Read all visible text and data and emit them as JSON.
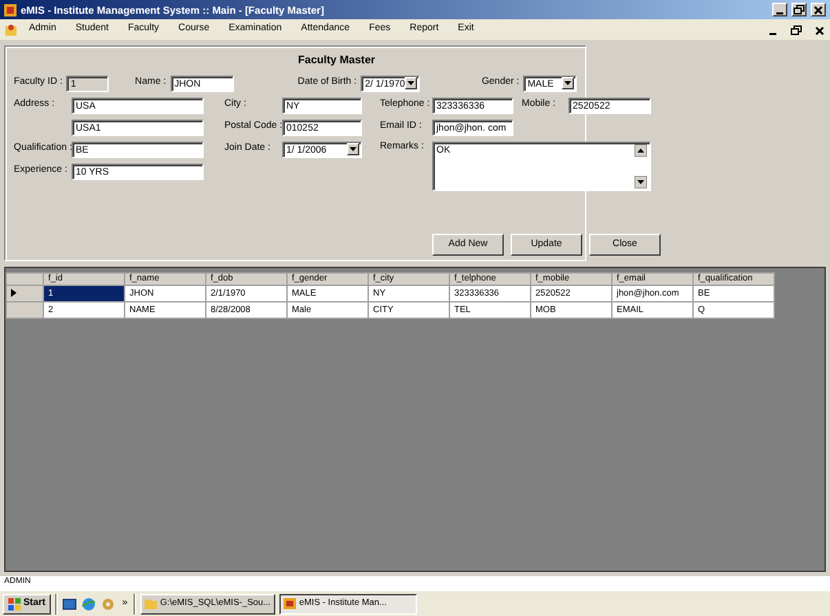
{
  "window": {
    "title": "eMIS - Institute Management System :: Main - [Faculty Master]"
  },
  "menu": {
    "items": [
      "Admin",
      "Student",
      "Faculty",
      "Course",
      "Examination",
      "Attendance",
      "Fees",
      "Report",
      "Exit"
    ]
  },
  "form": {
    "title": "Faculty Master",
    "fields": [
      {
        "label": "Faculty ID :",
        "value": "1",
        "kind": "readonly"
      },
      {
        "label": "Name :",
        "value": "JHON",
        "kind": "text"
      },
      {
        "label": "Date of Birth :",
        "value": "2/ 1/1970",
        "kind": "combo"
      },
      {
        "label": "Gender :",
        "value": "MALE",
        "kind": "combo"
      },
      {
        "label": "Address :",
        "value": "USA",
        "kind": "text"
      },
      {
        "label": "City :",
        "value": "NY",
        "kind": "text"
      },
      {
        "label": "Telephone :",
        "value": "323336336",
        "kind": "text"
      },
      {
        "label": "Mobile :",
        "value": "2520522",
        "kind": "text"
      },
      {
        "value": "USA1",
        "kind": "text"
      },
      {
        "label": "Postal Code :",
        "value": "010252",
        "kind": "text"
      },
      {
        "label": "Email ID :",
        "value": "jhon@jhon. com",
        "kind": "text"
      },
      {
        "label": "Qualification :",
        "value": "BE",
        "kind": "text"
      },
      {
        "label": "Join Date :",
        "value": "1/ 1/2006",
        "kind": "combo"
      },
      {
        "label": "Remarks :",
        "value": "OK",
        "kind": "textarea"
      },
      {
        "label": "Experience :",
        "value": "10 YRS",
        "kind": "text"
      }
    ],
    "buttons": [
      "Add New",
      "Update",
      "Close"
    ]
  },
  "grid": {
    "columns": [
      "f_id",
      "f_name",
      "f_dob",
      "f_gender",
      "f_city",
      "f_telphone",
      "f_mobile",
      "f_email",
      "f_qualification"
    ],
    "rows": [
      {
        "selected": true,
        "cells": [
          "1",
          "JHON",
          "2/1/1970",
          "MALE",
          "NY",
          "323336336",
          "2520522",
          "jhon@jhon.com",
          "BE"
        ]
      },
      {
        "selected": false,
        "cells": [
          "2",
          "NAME",
          "8/28/2008",
          "Male",
          "CITY",
          "TEL",
          "MOB",
          "EMAIL",
          "Q"
        ]
      }
    ]
  },
  "status_bar": "ADMIN",
  "taskbar": {
    "start": "Start",
    "more": "»",
    "tasks": [
      {
        "label": "G:\\eMIS_SQL\\eMIS-_Sou...",
        "selected": false
      },
      {
        "label": "eMIS - Institute Man...",
        "selected": true
      }
    ]
  }
}
